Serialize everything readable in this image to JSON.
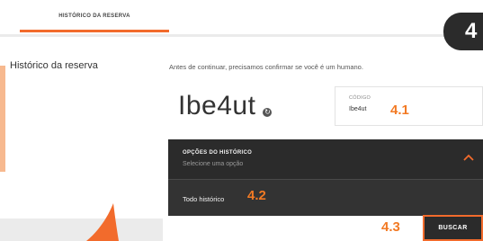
{
  "tabs": {
    "active": "HISTÓRICO DA RESERVA"
  },
  "sidebar": {
    "title": "Histórico da reserva"
  },
  "main": {
    "intro": "Antes de continuar, precisamos confirmar se você é um humano.",
    "captcha": {
      "text": "Ibe4ut",
      "refresh_icon": "refresh-icon"
    },
    "code_field": {
      "label": "CÓDIGO",
      "value": "Ibe4ut"
    }
  },
  "options": {
    "title": "OPÇÕES DO HISTÓRICO",
    "placeholder": "Selecione uma opção",
    "items": [
      {
        "label": "Todo histórico"
      }
    ]
  },
  "search_button": {
    "label": "BUSCAR"
  },
  "annotations": {
    "badge": "4",
    "step_41": "4.1",
    "step_42": "4.2",
    "step_43": "4.3"
  },
  "colors": {
    "accent": "#f26b2c",
    "step": "#f27a24",
    "dark_panel": "#2b2b2b",
    "background": "#ebebeb"
  }
}
